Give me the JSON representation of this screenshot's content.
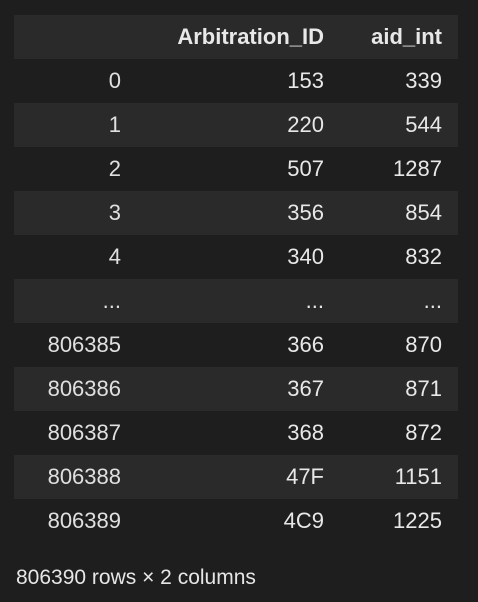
{
  "table": {
    "index_header": "",
    "columns": [
      "Arbitration_ID",
      "aid_int"
    ],
    "rows": [
      {
        "index": "0",
        "cells": [
          "153",
          "339"
        ]
      },
      {
        "index": "1",
        "cells": [
          "220",
          "544"
        ]
      },
      {
        "index": "2",
        "cells": [
          "507",
          "1287"
        ]
      },
      {
        "index": "3",
        "cells": [
          "356",
          "854"
        ]
      },
      {
        "index": "4",
        "cells": [
          "340",
          "832"
        ]
      },
      {
        "index": "...",
        "cells": [
          "...",
          "..."
        ]
      },
      {
        "index": "806385",
        "cells": [
          "366",
          "870"
        ]
      },
      {
        "index": "806386",
        "cells": [
          "367",
          "871"
        ]
      },
      {
        "index": "806387",
        "cells": [
          "368",
          "872"
        ]
      },
      {
        "index": "806388",
        "cells": [
          "47F",
          "1151"
        ]
      },
      {
        "index": "806389",
        "cells": [
          "4C9",
          "1225"
        ]
      }
    ]
  },
  "summary": "806390 rows × 2 columns",
  "colors": {
    "background": "#1e1e1e",
    "stripe": "#2a2a2a",
    "text": "#e6e6e6"
  }
}
